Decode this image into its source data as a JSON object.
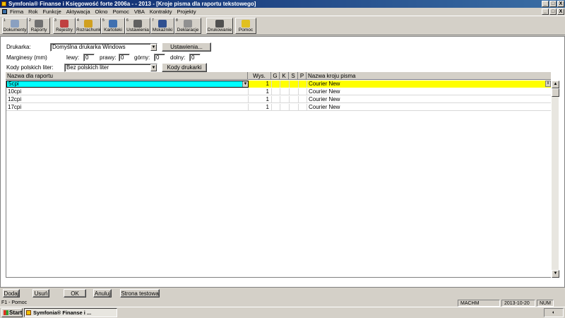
{
  "window": {
    "title": "Symfonia® Finanse i Księgowość forte 2006a -                  - 2013 - [Kroje pisma dla raportu tekstowego]",
    "min": "_",
    "max": "□",
    "close": "X",
    "mdi_min": "_",
    "mdi_max": "□",
    "mdi_close": "X"
  },
  "menu": [
    "Firma",
    "Rok",
    "Funkcje",
    "Aktywacja",
    "Okno",
    "Pomoc",
    "VBA",
    "Kontrakty",
    "Projekty"
  ],
  "toolbar": [
    {
      "num": "1",
      "label": "Dokumenty",
      "icon": "documents-icon",
      "color": "#8aa0c0"
    },
    {
      "num": "2",
      "label": "Raporty",
      "icon": "reports-icon",
      "color": "#707070"
    },
    {
      "num": "3",
      "label": "Rejestry",
      "icon": "registers-icon",
      "color": "#c04040"
    },
    {
      "num": "4",
      "label": "Rozrachunki",
      "icon": "settlements-icon",
      "color": "#d0a020"
    },
    {
      "num": "5",
      "label": "Kartoteki",
      "icon": "files-icon",
      "color": "#4070b0"
    },
    {
      "num": "6",
      "label": "Ustawienia",
      "icon": "settings-icon",
      "color": "#606060"
    },
    {
      "num": "7",
      "label": "Mskazniki",
      "icon": "indicators-icon",
      "color": "#305090"
    },
    {
      "num": "8",
      "label": "Deklaracje",
      "icon": "declarations-icon",
      "color": "#909090"
    },
    {
      "num": "",
      "label": "Drukowanie",
      "icon": "print-icon",
      "color": "#505050"
    },
    {
      "num": "",
      "label": "Pomoc",
      "icon": "help-icon",
      "color": "#e0c020"
    }
  ],
  "form": {
    "printer_label": "Drukarka:",
    "printer_value": "Domyślna drukarka Windows",
    "settings_button": "Ustawienia...",
    "margins_label": "Marginesy (mm)",
    "left_label": "lewy:",
    "left_value": "0",
    "right_label": "prawy:",
    "right_value": "0",
    "top_label": "górny:",
    "top_value": "0",
    "bottom_label": "dolny:",
    "bottom_value": "0",
    "polish_label": "Kody polskich liter:",
    "polish_value": "Bez polskich liter",
    "printer_codes_button": "Kody drukarki"
  },
  "grid": {
    "headers": [
      "Nazwa dla raportu",
      "Wys.",
      "G",
      "K",
      "S",
      "P",
      "Nazwa kroju pisma"
    ],
    "rows": [
      {
        "name": "5cpi",
        "height": "1",
        "font": "Courier New"
      },
      {
        "name": "10cpi",
        "height": "1",
        "font": "Courier New"
      },
      {
        "name": "12cpi",
        "height": "1",
        "font": "Courier New"
      },
      {
        "name": "17cpi",
        "height": "1",
        "font": "Courier New"
      }
    ]
  },
  "buttons": {
    "add": "Dodaj",
    "delete": "Usuń",
    "ok": "OK",
    "cancel": "Anuluj",
    "test_page": "Strona testowa"
  },
  "status": {
    "help": "F1 - Pomoc",
    "user": "MACHM",
    "date": "2013-10-20",
    "num": "NUM"
  },
  "taskbar": {
    "start": "Start",
    "task": "Symfonia® Finanse i ..."
  },
  "colors": {
    "selected_name": "#00ffff",
    "selected_font": "#ffff00",
    "title_start": "#0a246a"
  }
}
